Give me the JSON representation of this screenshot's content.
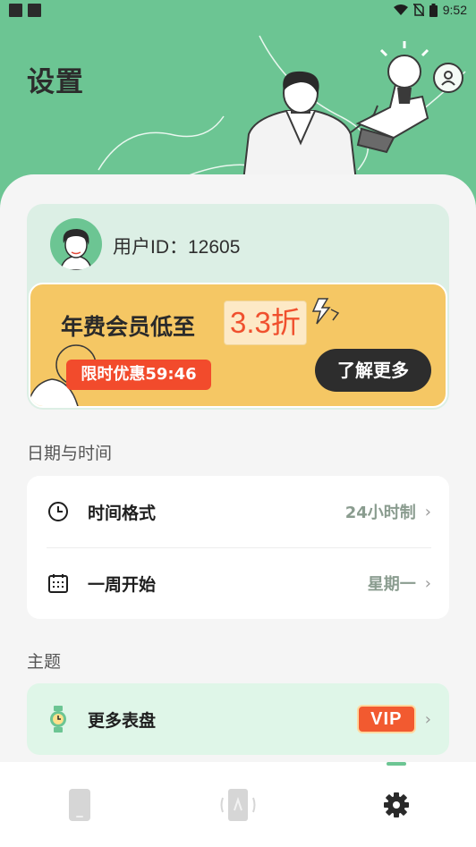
{
  "status_bar": {
    "time": "9:52"
  },
  "header": {
    "title": "设置"
  },
  "user": {
    "id_text": "用户ID：12605"
  },
  "promo": {
    "title": "年费会员低至",
    "discount": "3.3折",
    "timer": "限时优惠59:46",
    "button": "了解更多"
  },
  "section_date_time": {
    "label": "日期与时间",
    "rows": [
      {
        "label": "时间格式",
        "value": "24小时制",
        "icon": "clock-icon"
      },
      {
        "label": "一周开始",
        "value": "星期一",
        "icon": "calendar-icon"
      }
    ]
  },
  "section_theme": {
    "label": "主题",
    "rows": [
      {
        "label": "更多表盘",
        "badge": "VIP",
        "icon": "watch-icon"
      }
    ]
  },
  "nav": {
    "items": [
      {
        "icon": "phone-icon",
        "active": false
      },
      {
        "icon": "phone-rotate-icon",
        "active": false
      },
      {
        "icon": "gear-icon",
        "active": true
      }
    ]
  },
  "colors": {
    "brand_green": "#6cc593",
    "promo_yellow": "#f5c764",
    "accent_red": "#f24b2c",
    "dark": "#2d2d2d"
  }
}
